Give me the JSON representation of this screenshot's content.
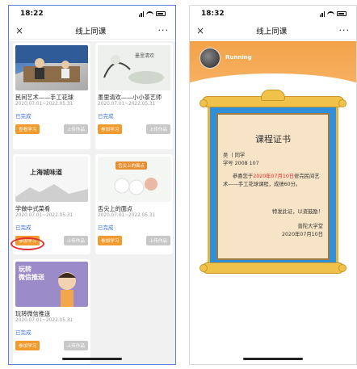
{
  "left": {
    "status_time": "18:22",
    "nav_title": "线上同课",
    "nav_close": "×",
    "nav_more": "···",
    "courses": [
      {
        "title": "民间艺术——手工花球",
        "date": "2020.07.01~2022.05.31",
        "status": "已完成",
        "primary_btn": "查看学习",
        "secondary_btn": "上传作品"
      },
      {
        "title": "墨里清欢——小小茶艺师",
        "date": "2020.07.01~2022.05.31",
        "status": "已完成",
        "primary_btn": "参加学习",
        "secondary_btn": "上传作品"
      },
      {
        "title": "学做中式菜肴",
        "date": "2020.07.01~2022.05.31",
        "status": "已完成",
        "primary_btn": "参加学习",
        "secondary_btn": "上传作品"
      },
      {
        "title": "舌尖上的面点",
        "date": "2020.07.01~2022.05.31",
        "status": "已完成",
        "primary_btn": "参加学习",
        "secondary_btn": "上传作品"
      },
      {
        "title": "玩转微信推送",
        "date": "2020.07.01~2022.05.31",
        "status": "已完成",
        "primary_btn": "参加学习",
        "secondary_btn": "上传作品"
      }
    ],
    "thumb_texts": {
      "c2_label": "墨里清欢",
      "c3_label": "上海城味道",
      "c4_label": "舌尖上的面点",
      "c5_label": "玩转\n微信推送"
    }
  },
  "right": {
    "status_time": "18:32",
    "nav_title": "线上同课",
    "nav_close": "×",
    "nav_more": "···",
    "username": "Running",
    "cert": {
      "title": "课程证书",
      "line_name": "吴 丨同学",
      "line_id": "学号 2008        107",
      "congrats_prefix": "恭喜您于",
      "congrats_date": "2020年07月10日",
      "congrats_suffix": "修完民间艺术——手工花球课程，成绩60分。",
      "encourage": "特发此证，以资鼓励！",
      "issuer": "普陀大学堂",
      "issue_date": "2020年07月10日"
    }
  },
  "colors": {
    "orange": "#f19a2e",
    "blue_link": "#3b73d9",
    "red": "#e02a2a"
  }
}
